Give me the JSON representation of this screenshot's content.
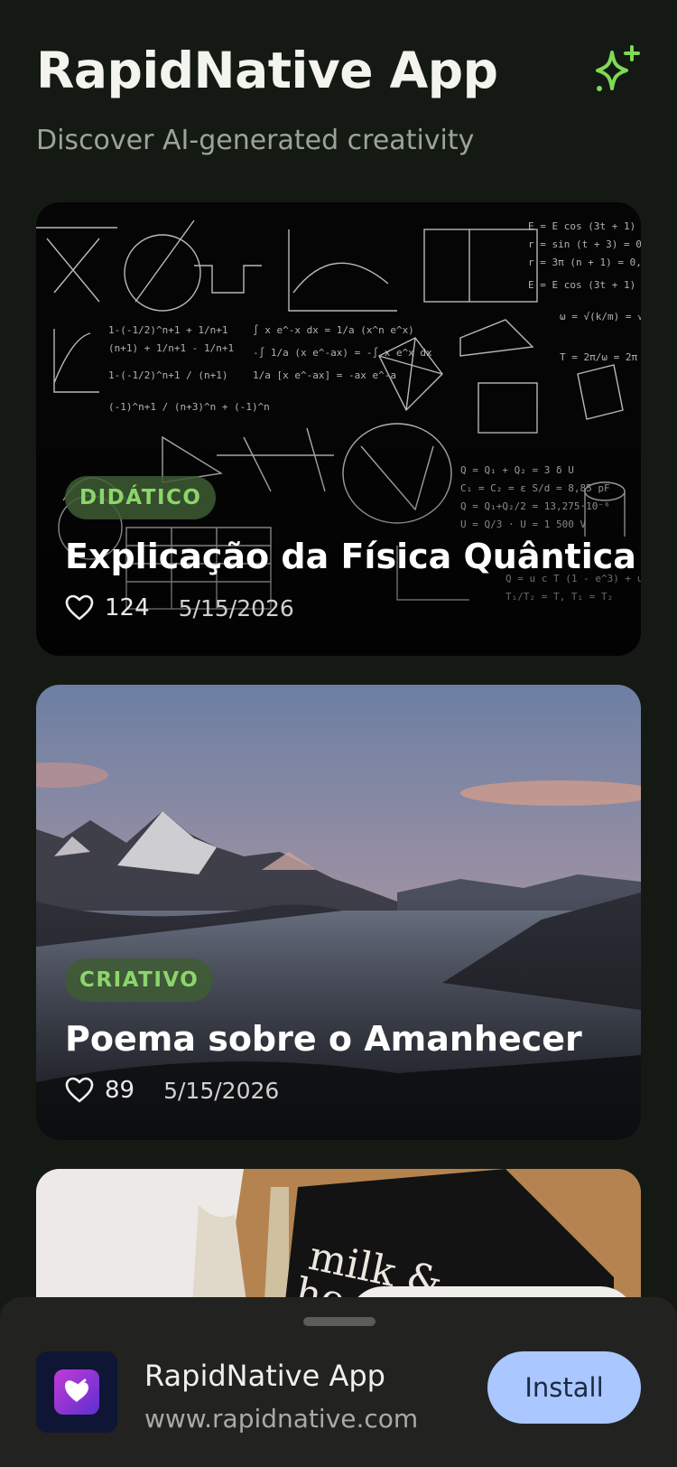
{
  "header": {
    "title": "RapidNative App",
    "subtitle": "Discover AI-generated creativity",
    "action_icon": "sparkle-icon",
    "accent_color": "#7ed957"
  },
  "cards": [
    {
      "tag": "DIDÁTICO",
      "title": "Explicação da Física Quântica",
      "likes": "124",
      "date": "5/15/2026",
      "image": "chalkboard-physics-formulas"
    },
    {
      "tag": "CRIATIVO",
      "title": "Poema sobre o Amanhecer",
      "likes": "89",
      "date": "5/15/2026",
      "image": "mountains-above-clouds-sunrise"
    },
    {
      "image": "milk-honey-book-on-wood"
    }
  ],
  "install_banner": {
    "app_name": "RapidNative App",
    "url": "www.rapidnative.com",
    "install_label": "Install",
    "install_color": "#aac7ff"
  }
}
